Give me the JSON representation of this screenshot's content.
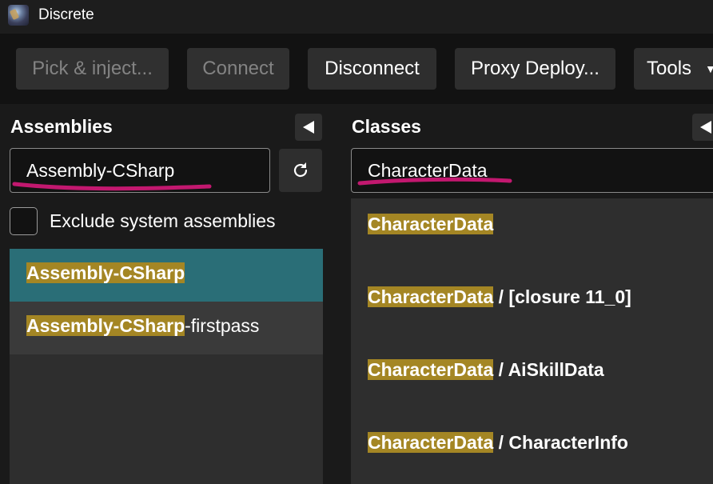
{
  "window": {
    "title": "Discrete",
    "icon": "app-logo-icon"
  },
  "toolbar": {
    "pick_inject": "Pick & inject...",
    "connect": "Connect",
    "disconnect": "Disconnect",
    "proxy_deploy": "Proxy Deploy...",
    "tools": "Tools"
  },
  "assemblies": {
    "title": "Assemblies",
    "search_value": "Assembly-CSharp",
    "exclude_label": "Exclude system assemblies",
    "exclude_checked": false,
    "items": [
      {
        "match": "Assembly-CSharp",
        "rest": ""
      },
      {
        "match": "Assembly-CSharp",
        "rest": "-firstpass"
      }
    ]
  },
  "classes": {
    "title": "Classes",
    "search_value": "CharacterData",
    "items": [
      {
        "match": "CharacterData",
        "rest": ""
      },
      {
        "match": "CharacterData",
        "rest": " / [closure 11_0]"
      },
      {
        "match": "CharacterData",
        "rest": " / AiSkillData"
      },
      {
        "match": "CharacterData",
        "rest": " / CharacterInfo"
      }
    ]
  },
  "colors": {
    "highlight": "#a48624",
    "selected_row": "#2a6e77",
    "annotation_underline": "#c2186f"
  }
}
